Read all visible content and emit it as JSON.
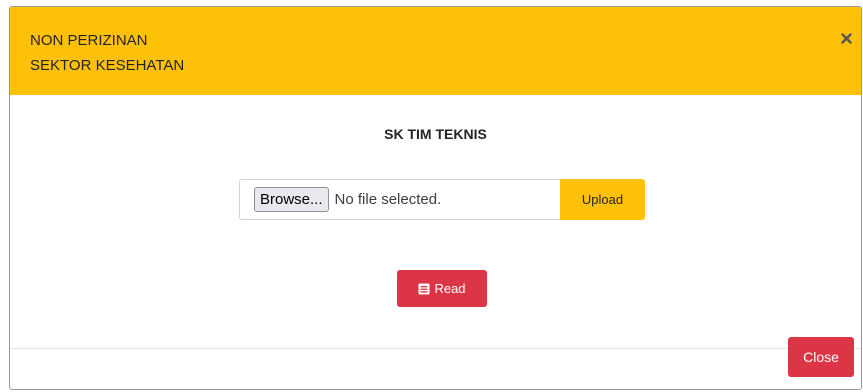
{
  "modal": {
    "header": {
      "title_line1": "NON PERIZINAN",
      "title_line2": "SEKTOR KESEHATAN",
      "close_icon": "close-icon",
      "background_color": "#ffc107"
    },
    "body": {
      "section_title": "SK TIM TEKNIS",
      "file_input": {
        "browse_label": "Browse...",
        "status_text": "No file selected."
      },
      "upload_label": "Upload",
      "read_button": {
        "icon": "book-icon",
        "label": "Read"
      }
    },
    "footer": {
      "close_label": "Close"
    },
    "colors": {
      "warning": "#ffc107",
      "danger": "#dc3545"
    }
  }
}
